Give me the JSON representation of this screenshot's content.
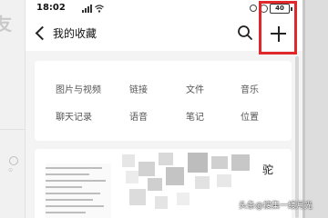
{
  "background": {
    "left_fragment": "友"
  },
  "status_bar": {
    "time": "18:02",
    "battery": "40"
  },
  "header": {
    "title": "我的收藏"
  },
  "categories": [
    {
      "label": "图片与视频",
      "icon": "photo-video"
    },
    {
      "label": "链接",
      "icon": "link"
    },
    {
      "label": "文件",
      "icon": "file"
    },
    {
      "label": "音乐",
      "icon": "music"
    },
    {
      "label": "聊天记录",
      "icon": "chat-history"
    },
    {
      "label": "语音",
      "icon": "voice"
    },
    {
      "label": "笔记",
      "icon": "note"
    },
    {
      "label": "位置",
      "icon": "location"
    }
  ],
  "item": {
    "trailing_char": "驼"
  },
  "watermark": "头条@搜集一缕月光",
  "colors": {
    "highlight": "#e0282b",
    "background": "#f4f4f4"
  }
}
